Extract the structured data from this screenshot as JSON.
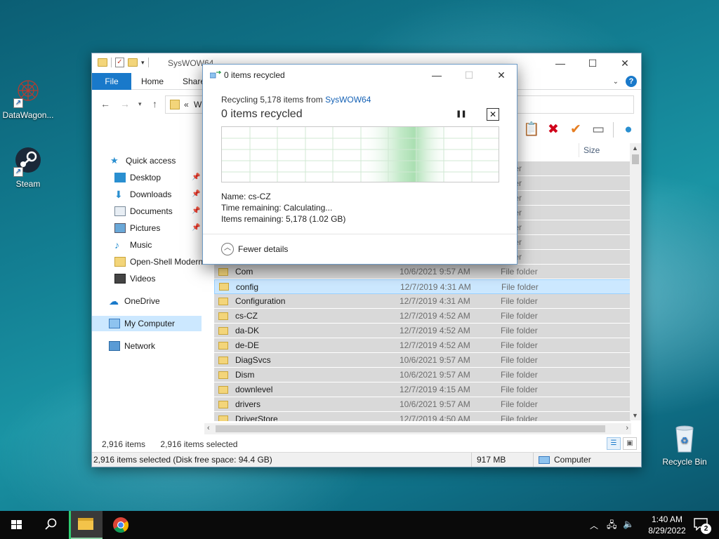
{
  "desktop": {
    "icons": [
      {
        "label": "DataWagon..."
      },
      {
        "label": "Steam"
      },
      {
        "label": "Recycle Bin"
      }
    ]
  },
  "explorer": {
    "title": "SysWOW64",
    "tabs": {
      "file": "File",
      "home": "Home",
      "share": "Share"
    },
    "address": {
      "chevrons": "«",
      "text": "W"
    },
    "nav": [
      {
        "label": "Quick access"
      },
      {
        "label": "Desktop"
      },
      {
        "label": "Downloads"
      },
      {
        "label": "Documents"
      },
      {
        "label": "Pictures"
      },
      {
        "label": "Music"
      },
      {
        "label": "Open-Shell Modern"
      },
      {
        "label": "Videos"
      },
      {
        "label": "OneDrive"
      },
      {
        "label": "My Computer"
      },
      {
        "label": "Network"
      }
    ],
    "columns": {
      "size": "Size"
    },
    "files": [
      {
        "name": "",
        "date": "",
        "type": "folder"
      },
      {
        "name": "",
        "date": "",
        "type": "folder"
      },
      {
        "name": "",
        "date": "",
        "type": "folder"
      },
      {
        "name": "",
        "date": "",
        "type": "folder"
      },
      {
        "name": "",
        "date": "",
        "type": "folder"
      },
      {
        "name": "",
        "date": "",
        "type": "folder"
      },
      {
        "name": "",
        "date": "",
        "type": "folder"
      },
      {
        "name": "Com",
        "date": "10/6/2021 9:57 AM",
        "type": "File folder"
      },
      {
        "name": "config",
        "date": "12/7/2019 4:31 AM",
        "type": "File folder"
      },
      {
        "name": "Configuration",
        "date": "12/7/2019 4:31 AM",
        "type": "File folder"
      },
      {
        "name": "cs-CZ",
        "date": "12/7/2019 4:52 AM",
        "type": "File folder"
      },
      {
        "name": "da-DK",
        "date": "12/7/2019 4:52 AM",
        "type": "File folder"
      },
      {
        "name": "de-DE",
        "date": "12/7/2019 4:52 AM",
        "type": "File folder"
      },
      {
        "name": "DiagSvcs",
        "date": "10/6/2021 9:57 AM",
        "type": "File folder"
      },
      {
        "name": "Dism",
        "date": "10/6/2021 9:57 AM",
        "type": "File folder"
      },
      {
        "name": "downlevel",
        "date": "12/7/2019 4:15 AM",
        "type": "File folder"
      },
      {
        "name": "drivers",
        "date": "10/6/2021 9:57 AM",
        "type": "File folder"
      },
      {
        "name": "DriverStore",
        "date": "12/7/2019 4:50 AM",
        "type": "File folder"
      }
    ],
    "status": {
      "count": "2,916 items",
      "selected": "2,916 items selected"
    },
    "bottom": {
      "selection": "2,916 items selected (Disk free space: 94.4 GB)",
      "size": "917 MB",
      "location": "Computer"
    }
  },
  "dialog": {
    "title": "0 items recycled",
    "from_prefix": "Recycling 5,178 items from ",
    "from_link": "SysWOW64",
    "main": "0 items recycled",
    "name": "Name:  cs-CZ",
    "time": "Time remaining:  Calculating...",
    "items": "Items remaining:  5,178 (1.02 GB)",
    "fewer": "Fewer details"
  },
  "taskbar": {
    "time": "1:40 AM",
    "date": "8/29/2022",
    "notifications": "2"
  },
  "colors": {
    "accent": "#1979ca",
    "selected_row": "#cce8ff",
    "progress_green": "#7fd08a"
  }
}
